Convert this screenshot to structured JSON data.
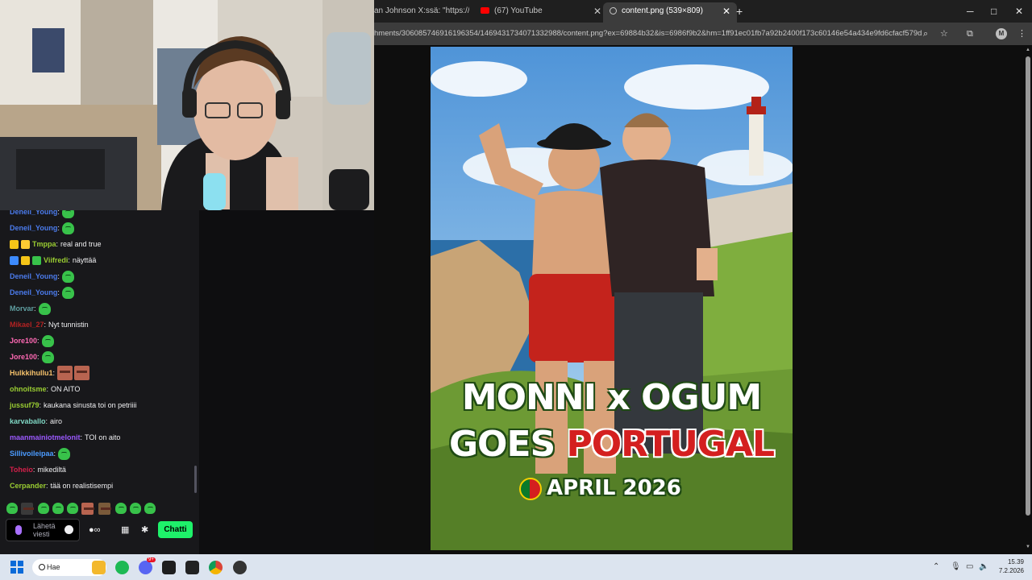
{
  "browser": {
    "tabs": [
      {
        "label": "an Johnson X:ssä: \"https://t...",
        "icon": "x-icon"
      },
      {
        "label": "(67) YouTube",
        "icon": "youtube-icon"
      },
      {
        "label": "content.png (539×809)",
        "icon": "document-icon",
        "active": true
      }
    ],
    "new_tab": "+",
    "window_controls": {
      "minimize": "─",
      "maximize": "□",
      "close": "✕"
    },
    "url": "hments/306085746916196354/1469431734071332988/content.png?ex=69884b32&is=6986f9b2&hm=1ff91ec01fb7a92b2400f173c60146e54a434e9fd6cfacf579d...",
    "profile_initial": "M"
  },
  "poster": {
    "line1": "MONNI x OGUM",
    "line2a": "GOES",
    "line2b": "PORTUGAL",
    "line3": "APRIL 2026"
  },
  "chat": {
    "messages": [
      {
        "user": "Deneil_Young",
        "color": "#4b7bec",
        "text": "",
        "emotes": 1
      },
      {
        "user": "Deneil_Young",
        "color": "#4b7bec",
        "text": "",
        "emotes": 1
      },
      {
        "user": "Tmppa",
        "color": "#9acd32",
        "text": "real and true",
        "emotes": 0
      },
      {
        "user": "Viifredi",
        "color": "#9acd32",
        "text": "näyttää",
        "emotes": 0
      },
      {
        "user": "Deneil_Young",
        "color": "#4b7bec",
        "text": "",
        "emotes": 1
      },
      {
        "user": "Deneil_Young",
        "color": "#4b7bec",
        "text": "",
        "emotes": 1
      },
      {
        "user": "Morvar",
        "color": "#5f9ea0",
        "text": "",
        "emotes": 1
      },
      {
        "user": "Mikael_27",
        "color": "#b22222",
        "text": "Nyt tunnistin",
        "emotes": 0
      },
      {
        "user": "Jore100",
        "color": "#ff69b4",
        "text": "",
        "emotes": 1
      },
      {
        "user": "Jore100",
        "color": "#ff69b4",
        "text": "",
        "emotes": 1
      },
      {
        "user": "Hulkkihullu1",
        "color": "#f4c06a",
        "text": "",
        "emotes": 0
      },
      {
        "user": "ohnoitsme",
        "color": "#9acd32",
        "text": "ON AITO",
        "emotes": 0
      },
      {
        "user": "jussuf79",
        "color": "#9acd32",
        "text": "kaukana sinusta toi on petriiii",
        "emotes": 0
      },
      {
        "user": "karvaballo",
        "color": "#7fd7c4",
        "text": "airo",
        "emotes": 0
      },
      {
        "user": "maanmainiotmelonit",
        "color": "#9b59ff",
        "text": "TOI on aito",
        "emotes": 0
      },
      {
        "user": "Sillivoileipaa",
        "color": "#4b9bff",
        "text": "",
        "emotes": 1
      },
      {
        "user": "Toheio",
        "color": "#d2204a",
        "text": "mikediltä",
        "emotes": 0
      },
      {
        "user": "Cerpander",
        "color": "#9acd32",
        "text": "tää on realistisempi",
        "emotes": 0
      }
    ],
    "input_placeholder": "Lähetä viesti",
    "send_button": "Chatti"
  },
  "taskbar": {
    "search": "Hae",
    "time": "15.39",
    "date": "7.2.2026",
    "notification_badge": "9+"
  },
  "colors": {
    "chat_button": "#1ef16a",
    "chat_bg": "#18181b",
    "accent_purple": "#a970ff"
  }
}
